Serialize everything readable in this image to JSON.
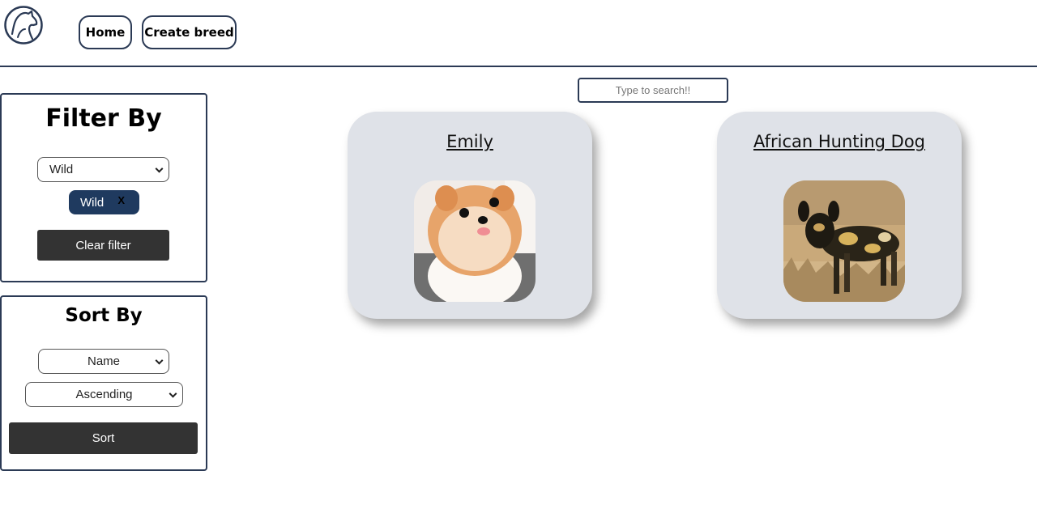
{
  "nav": {
    "home_label": "Home",
    "create_label": "Create breed"
  },
  "search": {
    "placeholder": "Type to search!!"
  },
  "filter_panel": {
    "title": "Filter By",
    "selected_option": "Wild",
    "active_filters": [
      {
        "label": "Wild",
        "remove_label": "X"
      }
    ],
    "clear_button_label": "Clear filter"
  },
  "sort_panel": {
    "title": "Sort By",
    "sort_field": "Name",
    "sort_order": "Ascending",
    "sort_button_label": "Sort"
  },
  "cards": [
    {
      "name": "Emily",
      "image": "pomeranian-puppy-photo"
    },
    {
      "name": "African Hunting Dog",
      "image": "african-wild-dog-photo"
    }
  ],
  "colors": {
    "navy_border": "#2b3a55",
    "chip_background": "#1f3a5f",
    "dark_button": "#333333",
    "card_background": "#dfe2e8"
  }
}
